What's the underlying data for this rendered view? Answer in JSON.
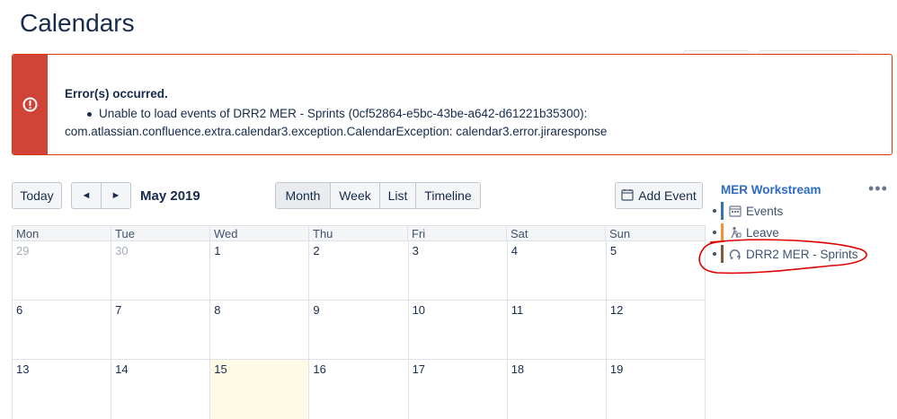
{
  "page": {
    "title": "Calendars"
  },
  "error": {
    "title": "Error(s) occurred.",
    "message_line1": "Unable to load events of DRR2 MER - Sprints (0cf52864-e5bc-43be-a642-d61221b35300):",
    "message_line2": "com.atlassian.confluence.extra.calendar3.exception.CalendarException: calendar3.error.jiraresponse",
    "color": "#d04437"
  },
  "toolbar": {
    "today_label": "Today",
    "prev_label": "◄",
    "next_label": "►",
    "month_label": "May 2019",
    "views": [
      "Month",
      "Week",
      "List",
      "Timeline"
    ],
    "selected_view": "Month",
    "add_event_label": "Add Event"
  },
  "calendar": {
    "weekdays": [
      "Mon",
      "Tue",
      "Wed",
      "Thu",
      "Fri",
      "Sat",
      "Sun"
    ],
    "weeks": [
      [
        "29",
        "30",
        "1",
        "2",
        "3",
        "4",
        "5"
      ],
      [
        "6",
        "7",
        "8",
        "9",
        "10",
        "11",
        "12"
      ],
      [
        "13",
        "14",
        "15",
        "16",
        "17",
        "18",
        "19"
      ]
    ],
    "today": "15"
  },
  "sidebar": {
    "calendar_name": "MER Workstream",
    "more_label": "•••",
    "subcalendars": [
      {
        "label": "Events",
        "color": "#3572b0",
        "icon": "calendar-icon"
      },
      {
        "label": "Leave",
        "color": "#f79232",
        "icon": "leave-icon"
      },
      {
        "label": "DRR2 MER - Sprints",
        "color": "#815b3a",
        "icon": "jira-sprint-icon"
      }
    ],
    "annotation_color": "#e00000"
  }
}
